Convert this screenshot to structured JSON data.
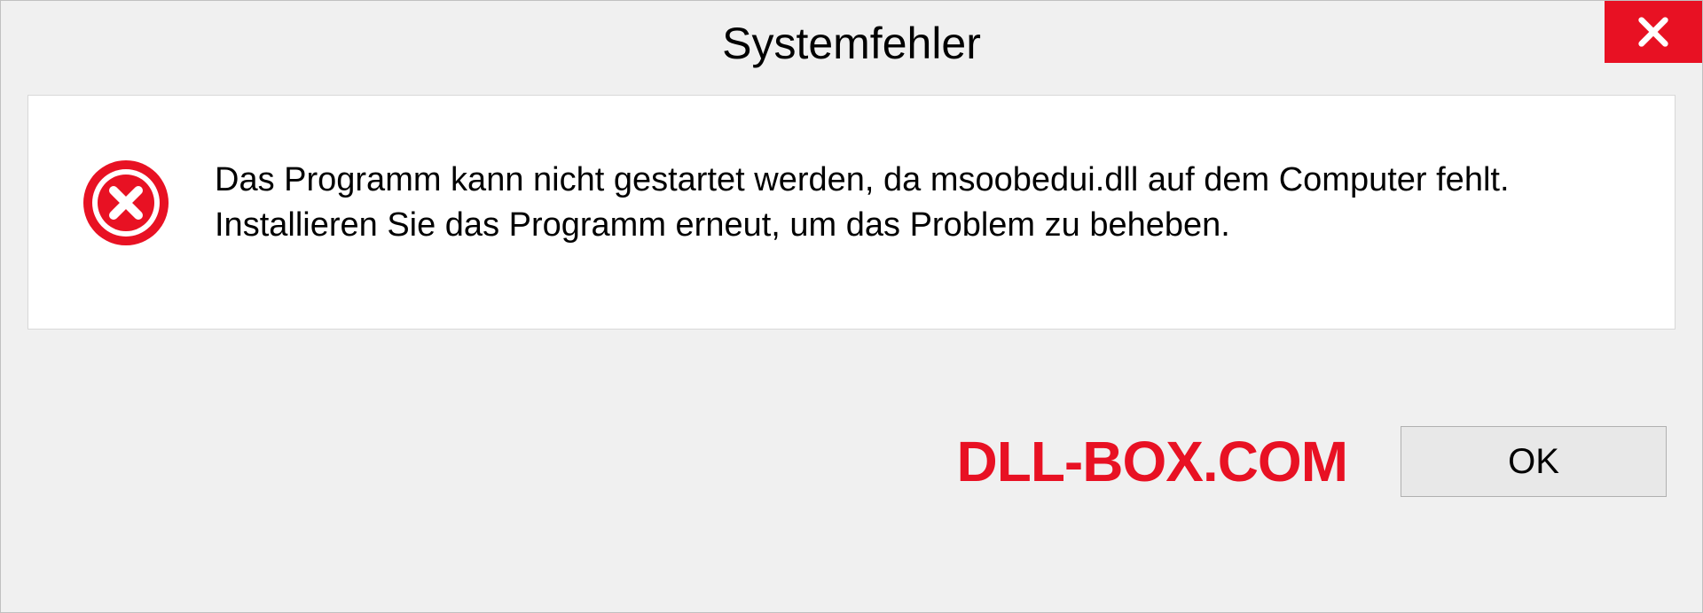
{
  "dialog": {
    "title": "Systemfehler",
    "message": "Das Programm kann nicht gestartet werden, da msoobedui.dll auf dem Computer fehlt. Installieren Sie das Programm erneut, um das Problem zu beheben.",
    "ok_label": "OK"
  },
  "watermark": "DLL-BOX.COM"
}
